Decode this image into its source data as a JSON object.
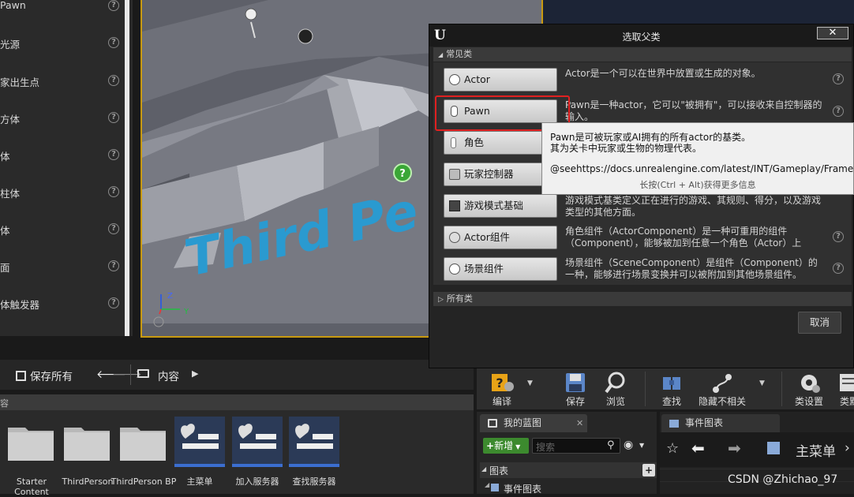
{
  "left_panel": {
    "items": [
      {
        "label": "Pawn"
      },
      {
        "label": "光源"
      },
      {
        "label": "家出生点"
      },
      {
        "label": "方体"
      },
      {
        "label": "体"
      },
      {
        "label": "柱体"
      },
      {
        "label": "体"
      },
      {
        "label": "面"
      },
      {
        "label": "体触发器"
      }
    ]
  },
  "viewport": {
    "text3d": "Third Pe",
    "axis_z": "Z",
    "axis_y": "Y"
  },
  "dialog": {
    "title": "选取父类",
    "close": "✕",
    "common_section": "常见类",
    "all_section": "所有类",
    "classes": [
      {
        "label": "Actor",
        "desc": "Actor是一个可以在世界中放置或生成的对象。",
        "icon": "sphere-icon"
      },
      {
        "label": "Pawn",
        "desc": "Pawn是一种actor，它可以\"被拥有\"，可以接收来自控制器的输入。",
        "icon": "pawn-icon"
      },
      {
        "label": "角色",
        "desc": "",
        "icon": "character-icon"
      },
      {
        "label": "玩家控制器",
        "desc": "",
        "icon": "controller-icon"
      },
      {
        "label": "游戏模式基础",
        "desc": "游戏模式基类定义正在进行的游戏、其规则、得分，以及游戏类型的其他方面。",
        "icon": "gamemode-icon"
      },
      {
        "label": "Actor组件",
        "desc": "角色组件（ActorComponent）是一种可重用的组件（Component），能够被加到任意一个角色（Actor）上",
        "icon": "component-icon"
      },
      {
        "label": "场景组件",
        "desc": "场景组件（SceneComponent）是组件（Component）的一种，能够进行场景变换并可以被附加到其他场景组件。",
        "icon": "scene-component-icon"
      }
    ],
    "cancel": "取消"
  },
  "tooltip": {
    "line1": "Pawn是可被玩家或AI拥有的所有actor的基类。",
    "line2": "其为关卡中玩家或生物的物理代表。",
    "line3": "@seehttps://docs.unrealengine.com/latest/INT/Gameplay/Framework/P",
    "hint": "长按(Ctrl + Alt)获得更多信息"
  },
  "content_browser": {
    "save_all": "保存所有",
    "content": "内容",
    "path_stub": "容",
    "assets": [
      {
        "name": "Starter Content",
        "type": "folder"
      },
      {
        "name": "ThirdPerson",
        "type": "folder"
      },
      {
        "name": "ThirdPerson BP",
        "type": "folder"
      },
      {
        "name": "主菜单",
        "type": "widget"
      },
      {
        "name": "加入服务器",
        "type": "widget"
      },
      {
        "name": "查找服务器",
        "type": "widget"
      }
    ]
  },
  "blueprint_toolbar": {
    "buttons": [
      {
        "label": "编译",
        "icon": "compile-icon"
      },
      {
        "label": "保存",
        "icon": "save-icon"
      },
      {
        "label": "浏览",
        "icon": "browse-icon"
      },
      {
        "label": "查找",
        "icon": "find-icon"
      },
      {
        "label": "隐藏不相关",
        "icon": "hide-unrelated-icon"
      },
      {
        "label": "类设置",
        "icon": "class-settings-icon"
      },
      {
        "label": "类默",
        "icon": "class-defaults-icon"
      }
    ]
  },
  "my_blueprint": {
    "tab": "我的蓝图",
    "new_btn": "新增",
    "search_placeholder": "搜索",
    "graphs": "图表",
    "event_graph": "事件图表"
  },
  "graph_panel": {
    "tab": "事件图表",
    "breadcrumb": "主菜单"
  },
  "watermark": "CSDN @Zhichao_97",
  "colors": {
    "highlight": "#e02020",
    "viewport_border": "#c99a10",
    "add_green": "#3c8a2e"
  }
}
